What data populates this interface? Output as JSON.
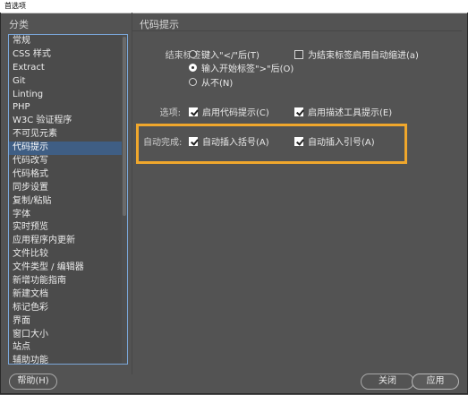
{
  "window": {
    "title": "首选项"
  },
  "sidebar": {
    "header": "分类",
    "selected_index": 9,
    "items": [
      "常规",
      "CSS 样式",
      "Extract",
      "Git",
      "Linting",
      "PHP",
      "W3C 验证程序",
      "不可见元素",
      "代码提示",
      "代码改写",
      "代码格式",
      "同步设置",
      "复制/粘贴",
      "字体",
      "实时预览",
      "应用程序内更新",
      "文件比较",
      "文件类型 / 编辑器",
      "新增功能指南",
      "新建文档",
      "标记色彩",
      "界面",
      "窗口大小",
      "站点",
      "辅助功能"
    ]
  },
  "panel": {
    "title": "代码提示",
    "close_tags": {
      "label": "结束标签:",
      "options": [
        {
          "label": "键入\"</\"后(T)",
          "selected": false
        },
        {
          "label": "输入开始标签\">\"后(O)",
          "selected": true
        },
        {
          "label": "从不(N)",
          "selected": false
        }
      ],
      "auto_indent": {
        "label": "为结束标签启用自动缩进(a)",
        "checked": false
      }
    },
    "options_row": {
      "label": "选项:",
      "enable_hints": {
        "label": "启用代码提示(C)",
        "checked": true
      },
      "enable_tool_desc": {
        "label": "启用描述工具提示(E)",
        "checked": true
      }
    },
    "autocomplete": {
      "label": "自动完成:",
      "insert_brackets": {
        "label": "自动插入括号(A)",
        "checked": true
      },
      "insert_quotes": {
        "label": "自动插入引号(A)",
        "checked": true
      }
    }
  },
  "footer": {
    "help_label": "帮助(H)",
    "close_label": "关闭",
    "apply_label": "应用"
  },
  "colors": {
    "highlight": "#f0a72c",
    "selection": "#3f5e84",
    "list_border": "#7aa6d8"
  }
}
